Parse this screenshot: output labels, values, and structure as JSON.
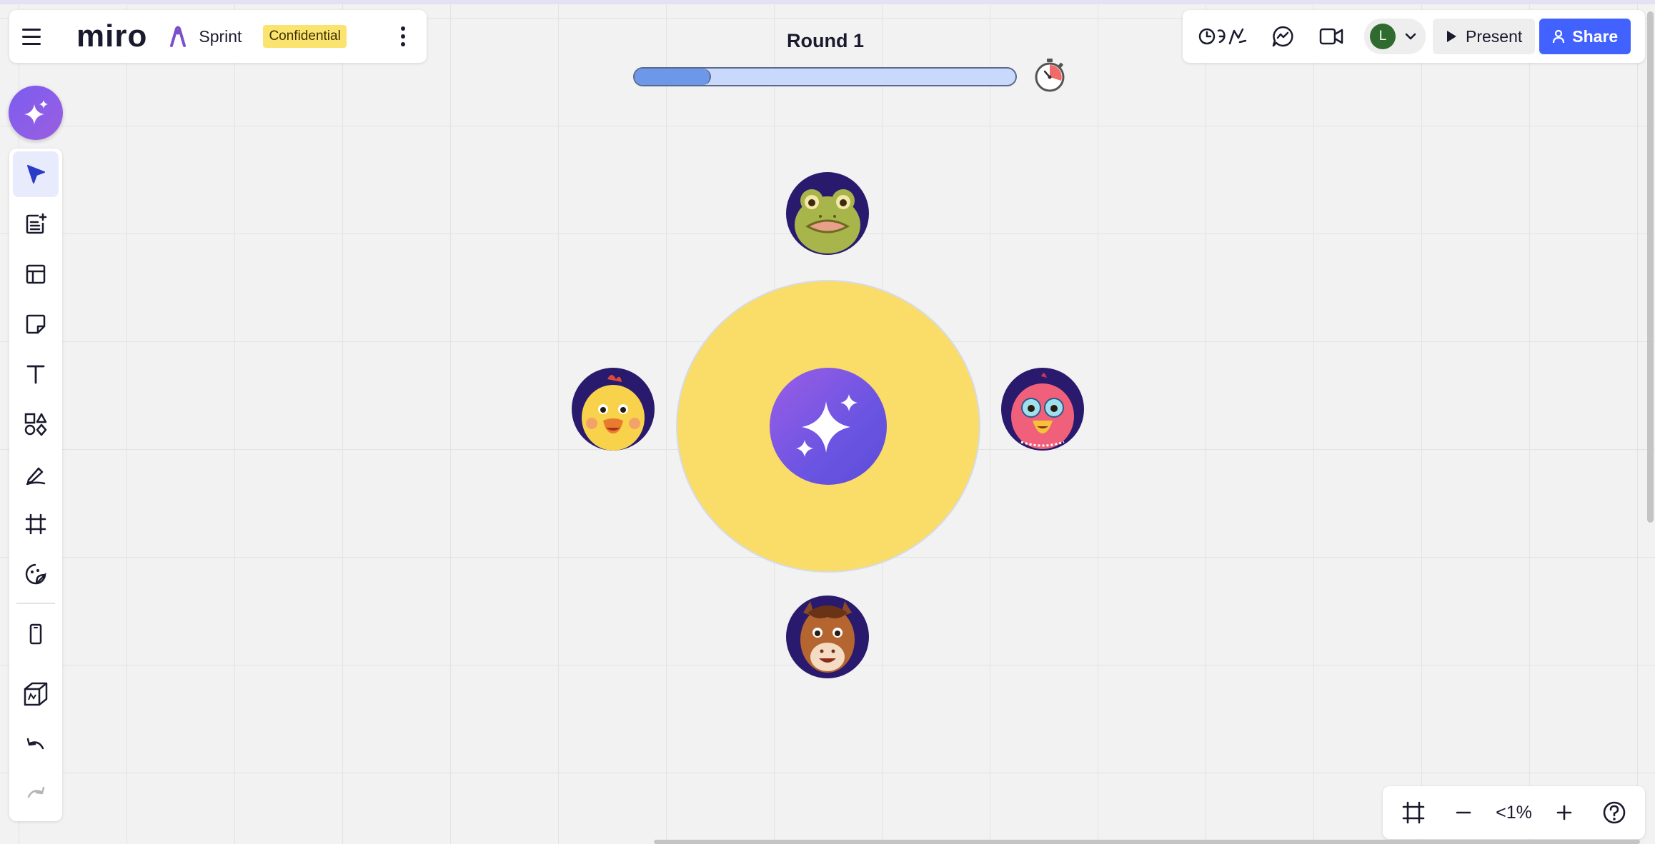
{
  "app": {
    "logo": "miro",
    "board_name": "Sprint",
    "classification_badge": "Confidential"
  },
  "icons": {
    "menu": "hamburger-icon",
    "board": "sprint-board-icon",
    "more": "kebab-icon",
    "reactions": "reactions-icon",
    "chat": "chat-icon",
    "video": "video-call-icon",
    "dropdown": "chevron-down-icon",
    "present": "play-icon",
    "share": "person-icon",
    "timer": "stopwatch-icon",
    "ai": "sparkle-icon"
  },
  "game": {
    "round_label": "Round 1",
    "progress": 0.2
  },
  "header_right": {
    "avatar_initial": "L",
    "present_label": "Present",
    "share_label": "Share"
  },
  "toolbar": {
    "items": [
      {
        "name": "select",
        "icon": "cursor-icon",
        "active": true
      },
      {
        "name": "templates",
        "icon": "doc-add-icon",
        "active": false
      },
      {
        "name": "frames-layout",
        "icon": "layout-icon",
        "active": false
      },
      {
        "name": "sticky-note",
        "icon": "sticky-note-icon",
        "active": false
      },
      {
        "name": "text",
        "icon": "text-icon",
        "active": false
      },
      {
        "name": "shapes",
        "icon": "shapes-icon",
        "active": false
      },
      {
        "name": "pen",
        "icon": "pen-icon",
        "active": false
      },
      {
        "name": "frame",
        "icon": "frame-icon",
        "active": false
      },
      {
        "name": "stickers",
        "icon": "sticker-icon",
        "active": false
      },
      {
        "name": "device",
        "icon": "phone-icon",
        "active": false
      },
      {
        "name": "3d",
        "icon": "cube-icon",
        "active": false
      },
      {
        "name": "undo",
        "icon": "undo-icon",
        "active": false
      },
      {
        "name": "redo",
        "icon": "redo-icon",
        "active": false
      }
    ]
  },
  "zoom": {
    "level": "<1%",
    "fit_icon": "fit-frame-icon",
    "minus_icon": "minus-icon",
    "plus_icon": "plus-icon",
    "help_icon": "help-icon"
  },
  "players": [
    {
      "name": "frog",
      "icon": "frog-avatar-icon"
    },
    {
      "name": "chick",
      "icon": "chick-avatar-icon"
    },
    {
      "name": "bird",
      "icon": "red-bird-avatar-icon"
    },
    {
      "name": "horse",
      "icon": "horse-avatar-icon"
    }
  ],
  "colors": {
    "accent": "#4262ff",
    "table": "#fadc68",
    "progress_fill": "#6d97e8",
    "progress_track": "#c9d9fb",
    "badge": "#fbe36f"
  }
}
